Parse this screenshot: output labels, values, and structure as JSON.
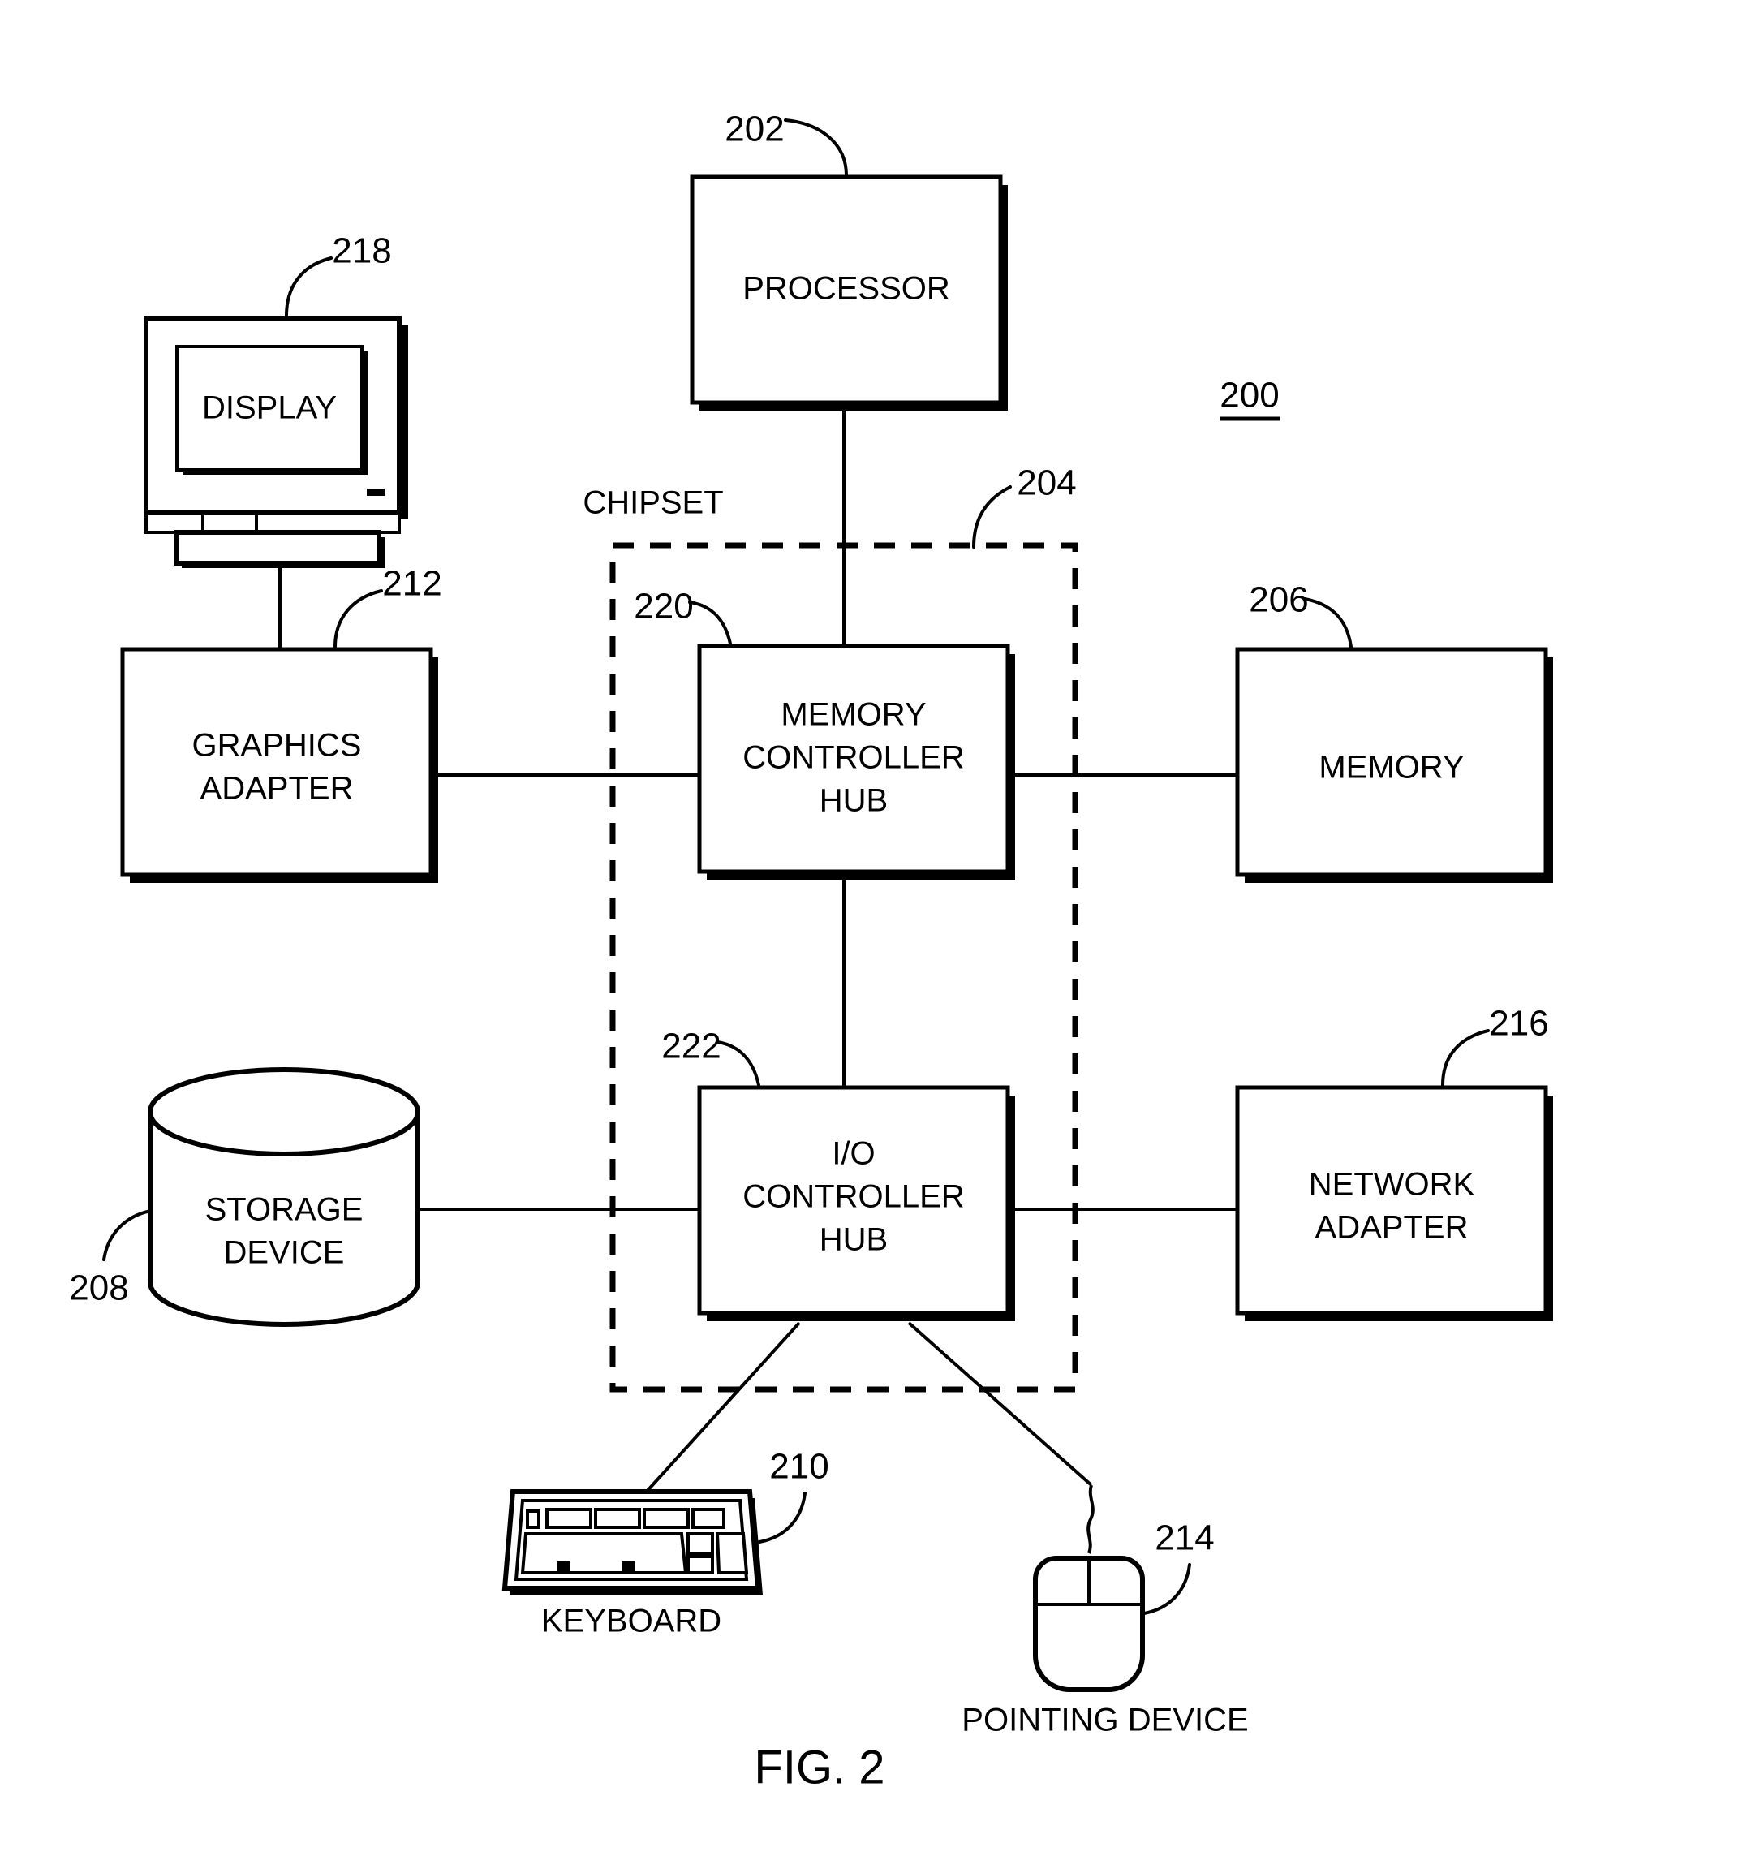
{
  "figure": {
    "caption": "FIG. 2",
    "system_ref": "200"
  },
  "blocks": [
    {
      "id": "processor",
      "label_lines": [
        "PROCESSOR"
      ],
      "ref": "202"
    },
    {
      "id": "memory-controller-hub",
      "label_lines": [
        "MEMORY",
        "CONTROLLER",
        "HUB"
      ],
      "ref": "220"
    },
    {
      "id": "io-controller-hub",
      "label_lines": [
        "I/O",
        "CONTROLLER",
        "HUB"
      ],
      "ref": "222"
    },
    {
      "id": "graphics-adapter",
      "label_lines": [
        "GRAPHICS",
        "ADAPTER"
      ],
      "ref": "212"
    },
    {
      "id": "memory",
      "label_lines": [
        "MEMORY"
      ],
      "ref": "206"
    },
    {
      "id": "network-adapter",
      "label_lines": [
        "NETWORK",
        "ADAPTER"
      ],
      "ref": "216"
    }
  ],
  "chipset": {
    "label": "CHIPSET",
    "ref": "204"
  },
  "devices": [
    {
      "id": "display",
      "label": "DISPLAY",
      "ref": "218"
    },
    {
      "id": "storage-device",
      "label_lines": [
        "STORAGE",
        "DEVICE"
      ],
      "ref": "208"
    },
    {
      "id": "keyboard",
      "label": "KEYBOARD",
      "ref": "210"
    },
    {
      "id": "pointing-device",
      "label": "POINTING DEVICE",
      "ref": "214"
    }
  ],
  "colors": {
    "ink": "#000000",
    "paper": "#ffffff"
  }
}
